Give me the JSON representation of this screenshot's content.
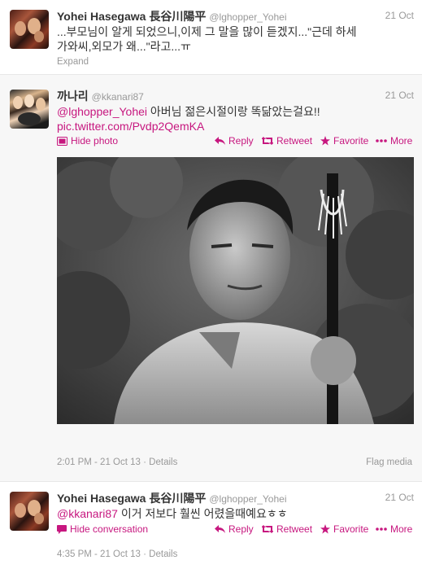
{
  "tweets": [
    {
      "name": "Yohei Hasegawa 長谷川陽平",
      "handle": "@lghopper_Yohei",
      "time": "21 Oct",
      "text_line1": "...부모님이 알게 되었으니,이제 그 말을 많이 듣겠지...\"근데 하세",
      "text_line2": "가와씨,외모가 왜...\"라고...ㅠ",
      "expand": "Expand"
    },
    {
      "name": "까나리",
      "handle": "@kkanari87",
      "time": "21 Oct",
      "mention": "@lghopper_Yohei",
      "text": "아버님 젊은시절이랑 똑닮았는걸요!!",
      "pic_link": "pic.twitter.com/Pvdp2QemKA",
      "hide_photo": "Hide photo",
      "reply": "Reply",
      "retweet": "Retweet",
      "favorite": "Favorite",
      "more": "More",
      "timestamp": "2:01 PM - 21 Oct 13",
      "details": "Details",
      "flag_media": "Flag media"
    },
    {
      "name": "Yohei Hasegawa 長谷川陽平",
      "handle": "@lghopper_Yohei",
      "time": "21 Oct",
      "mention": "@kkanari87",
      "text": "이거 저보다 훨씬 어렸을때예요ㅎㅎ",
      "hide_conversation": "Hide conversation",
      "reply": "Reply",
      "retweet": "Retweet",
      "favorite": "Favorite",
      "more": "More",
      "timestamp": "4:35 PM - 21 Oct 13",
      "details": "Details"
    }
  ],
  "separator": "·",
  "colors": {
    "accent": "#c7177f",
    "muted": "#999999",
    "text": "#333333"
  },
  "icons": [
    "photo-icon",
    "reply-icon",
    "retweet-icon",
    "favorite-icon",
    "more-icon",
    "conversation-icon"
  ]
}
